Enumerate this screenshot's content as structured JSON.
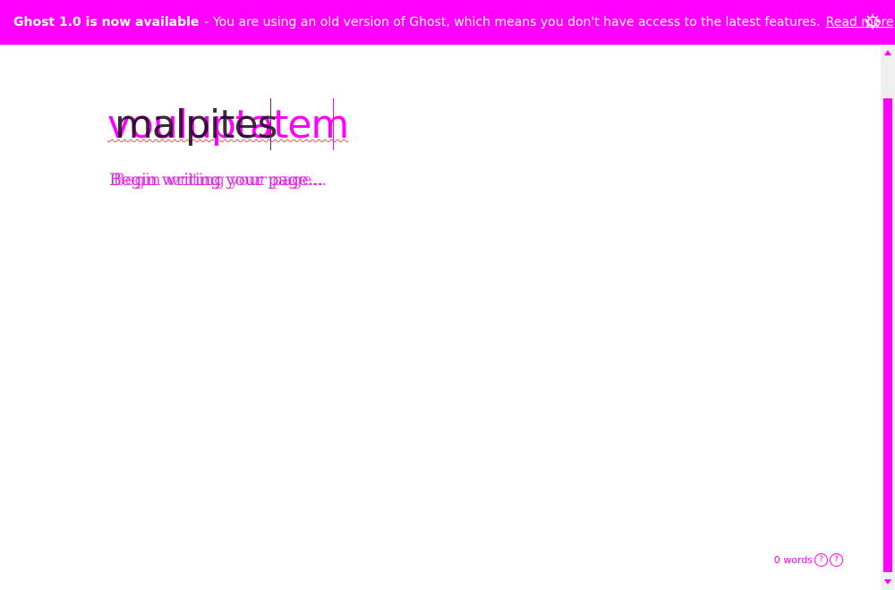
{
  "banner": {
    "title": "Ghost 1.0 is now available",
    "message": "- You are using an old version of Ghost, which means you don't have access to the latest features.",
    "link_label": "Read more",
    "background": "#ff00ff",
    "close_icon": "gear-close-icon"
  },
  "editor": {
    "title_text": "malpites",
    "title_highlight": "vouluptatem",
    "body_placeholder": "Begin writing your page...",
    "accent": "#ff00ff"
  },
  "footer": {
    "word_count": "0 words",
    "help_label": "?"
  }
}
